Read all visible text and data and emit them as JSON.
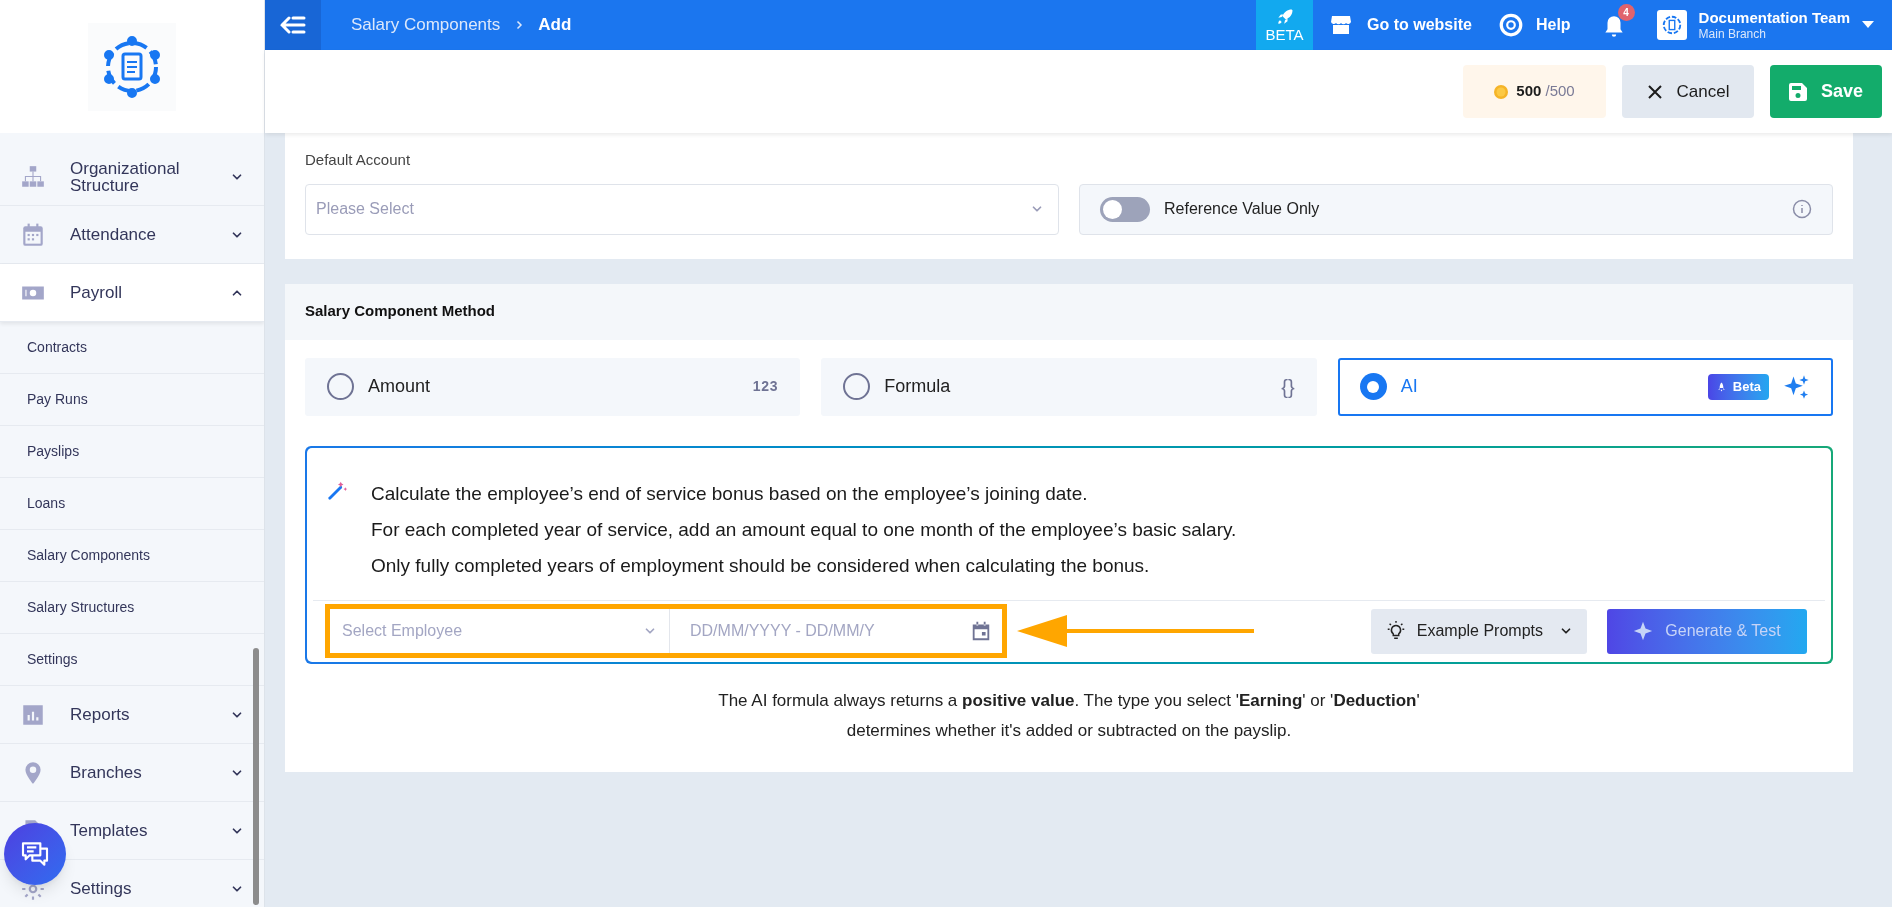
{
  "topbar": {
    "breadcrumb": [
      "Salary Components",
      "Add"
    ],
    "beta": "BETA",
    "website": "Go to website",
    "help": "Help",
    "notifications": "4",
    "user": {
      "name": "Documentation Team",
      "branch": "Main Branch"
    }
  },
  "toolbar": {
    "credits": "500",
    "credits_total": "/500",
    "cancel": "Cancel",
    "save": "Save"
  },
  "sidebar": {
    "items": [
      {
        "label": "Organizational Structure",
        "expanded": false
      },
      {
        "label": "Attendance",
        "expanded": false
      },
      {
        "label": "Payroll",
        "expanded": true,
        "children": [
          {
            "label": "Contracts",
            "selected": false
          },
          {
            "label": "Pay Runs",
            "selected": false
          },
          {
            "label": "Payslips",
            "selected": false
          },
          {
            "label": "Loans",
            "selected": false
          },
          {
            "label": "Salary Components",
            "selected": false
          },
          {
            "label": "Salary Structures",
            "selected": false
          },
          {
            "label": "Settings",
            "selected": false
          }
        ]
      },
      {
        "label": "Reports",
        "expanded": false
      },
      {
        "label": "Branches",
        "expanded": false
      },
      {
        "label": "Templates",
        "expanded": false
      },
      {
        "label": "Settings",
        "expanded": false
      }
    ]
  },
  "default_account": {
    "label": "Default Account",
    "placeholder": "Please Select"
  },
  "reference_value": {
    "label": "Reference Value Only",
    "on": false
  },
  "method": {
    "title": "Salary Component Method",
    "options": [
      {
        "label": "Amount",
        "hint": "123",
        "selected": false
      },
      {
        "label": "Formula",
        "hint": "{}",
        "selected": false
      },
      {
        "label": "AI",
        "badge": "Beta",
        "selected": true
      }
    ]
  },
  "ai_prompt": {
    "lines": [
      "Calculate the employee’s end of service bonus based on the employee’s joining date.",
      "For each completed year of service, add an amount equal to one month of the employee’s basic salary.",
      "Only fully completed years of employment should be considered when calculating the bonus."
    ],
    "employee_placeholder": "Select Employee",
    "date_placeholder": "DD/MM/YYYY - DD/MM/Y",
    "examples": "Example Prompts",
    "generate": "Generate & Test"
  },
  "note": "The AI formula always returns a **positive value**. The type you select '**Earning**' or '**Deduction**' determines whether it's added or subtracted on the payslip."
}
